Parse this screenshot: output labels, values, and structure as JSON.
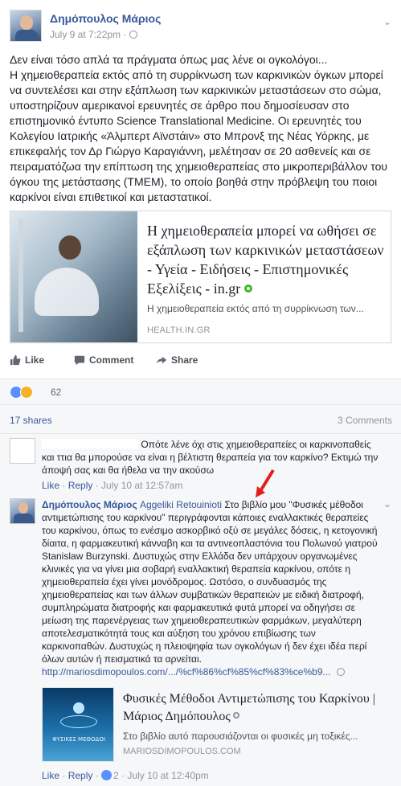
{
  "post": {
    "author": "Δημόπουλος Μάριος",
    "time": "July 9 at 7:22pm ·",
    "text": "Δεν είναι τόσο απλά τα πράγματα όπως μας λένε οι ογκολόγοι...\nΗ χημειοθεραπεία εκτός από τη συρρίκνωση των καρκινικών όγκων μπορεί να συντελέσει και στην εξάπλωση των καρκινικών μεταστάσεων στο σώμα, υποστηρίζουν αμερικανοί ερευνητές σε άρθρο που δημοσίευσαν στο επιστημονικό έντυπο Science Translational Medicine. Οι ερευνητές του Κολεγίου Ιατρικής «Άλμπερτ Αϊνστάιν» στο Μπρονξ της Νέας Υόρκης, με επικεφαλής τον Δρ Γιώργο Καραγιάννη, μελέτησαν σε 20 ασθενείς και σε πειραματόζωα την επίπτωση της χημειοθεραπείας στο μικροπεριβάλλον του όγκου της μετάστασης (ΤΜΕΜ), το οποίο βοηθά στην πρόβλεψη του ποιοι καρκίνοι είναι επιθετικοί και μεταστατικοί."
  },
  "link_card": {
    "title": "Η χημειοθεραπεία μπορεί να ωθήσει σε εξάπλωση των καρκινικών μεταστάσεων - Υγεία - Ειδήσεις - Επιστημονικές Εξελίξεις - in.gr",
    "description": "Η χημειοθεραπεία εκτός από τη συρρίκνωση των...",
    "domain": "HEALTH.IN.GR"
  },
  "actions": {
    "like": "Like",
    "comment": "Comment",
    "share": "Share"
  },
  "reactions": {
    "count": "62",
    "icons": [
      "like-icon",
      "wow-icon"
    ]
  },
  "stats": {
    "shares": "17 shares",
    "comments": "3 Comments"
  },
  "comments": [
    {
      "text": "Οπότε λένε όχι στις χημειοθεραπείες οι καρκινοπαθείς και ττια θα μπορούσε να είναι η βέλτιστη θεραπεία για τον καρκίνο? Εκτιμώ την άποψή σας και θα ήθελα να την ακούσω",
      "like": "Like",
      "reply": "Reply",
      "time": "July 10 at 12:57am"
    },
    {
      "author": "Δημόπουλος Μάριος",
      "mention": "Aggeliki Retouinioti",
      "text": "Στο βιβλίο μου \"Φυσικές μέθοδοι αντιμετώπισης του καρκίνου\" περιγράφονται κάποιες εναλλακτικές θεραπείες του καρκίνου, όπως το ενέσιμο ασκορβικό οξύ σε μεγάλες δόσεις, η κετογονική δίαιτα, η φαρμακευτική κάνναβη και τα αντινεοπλαστόνια του Πολωνού γιατρού Stanislaw Burzynski. Δυστυχώς στην Ελλάδα δεν υπάρχουν οργανωμένες κλινικές για να γίνει μια σοβαρή εναλλακτική θεραπεία καρκίνου, οπότε η χημειοθεραπεία έχει γίνει μονόδρομος. Ωστόσο, ο συνδυασμός της χημειοθεραπείας και των άλλων συμβατικών θεραπειών με ειδική διατροφή, συμπληρώματα διατροφής και φαρμακευτικά φυτά μπορεί να οδηγήσει σε μείωση της παρενέργειας των χημειοθεραπευτικών φαρμάκων, μεγαλύτερη αποτελεσματικότητά τους και αύξηση του χρόνου επιβίωσης των καρκινοπαθών. Δυστυχώς η πλειοψηφία των ογκολόγων ή δεν έχει ιδέα περί όλων αυτών ή πεισματικά τα αρνείται.",
      "link": "http://mariosdimopoulos.com/.../%cf%86%cf%85%cf%83%ce%b9...",
      "like": "Like",
      "reply": "Reply",
      "likes": "2",
      "time": "July 10 at 12:40pm"
    }
  ],
  "book_card": {
    "image_title": "ΦΥΣΙΚΕΣ ΜΕΘΟΔΟΙ",
    "title": "Φυσικές Μέθοδοι Αντιμετώπισης του Καρκίνου | Μάριος Δημόπουλος",
    "description": "Στο βιβλίο αυτό παρουσιάζονται οι φυσικές μη τοξικές...",
    "domain": "MARIOSDIMOPOULOS.COM"
  }
}
